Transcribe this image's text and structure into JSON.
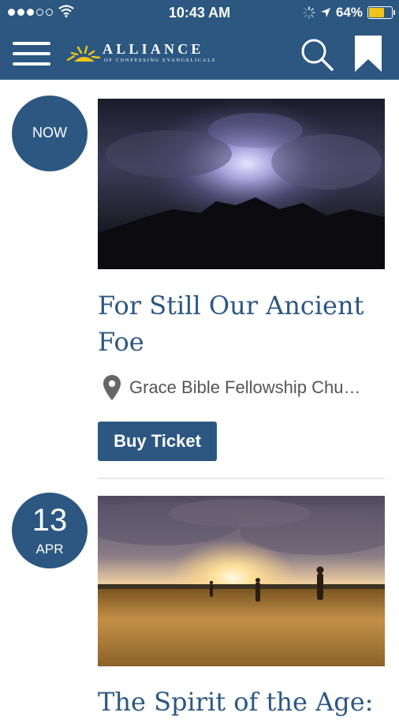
{
  "status_bar": {
    "time": "10:43 AM",
    "battery_percent": "64%",
    "battery_level": 0.64
  },
  "header": {
    "logo_name": "ALLIANCE",
    "logo_tagline": "OF CONFESSING EVANGELICALS",
    "icons": [
      "menu-icon",
      "search-icon",
      "bookmark-icon"
    ]
  },
  "events": [
    {
      "date_label": "NOW",
      "title_line1": "For Still Our Ancient",
      "title_line2": "Foe",
      "location": "Grace Bible Fellowship Chu…",
      "button_label": "Buy Ticket"
    },
    {
      "day": "13",
      "month": "APR",
      "title": "The Spirit of the Age:"
    }
  ],
  "colors": {
    "brand_blue": "#2b5781",
    "battery": "#f0c419",
    "location_text": "#555555"
  }
}
